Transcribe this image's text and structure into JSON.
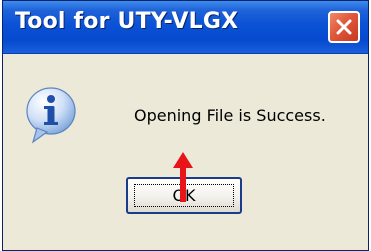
{
  "window": {
    "title": "Tool for UTY-VLGX",
    "close_icon": "close-icon"
  },
  "dialog": {
    "icon": "info-icon",
    "message": "Opening File is Success.",
    "ok_label": "OK"
  },
  "annotation": {
    "icon": "red-arrow-icon",
    "color": "#e8141a"
  },
  "colors": {
    "titlebar": "#0a52d6",
    "close_button": "#e0573a",
    "dialog_background": "#ece9d8"
  }
}
